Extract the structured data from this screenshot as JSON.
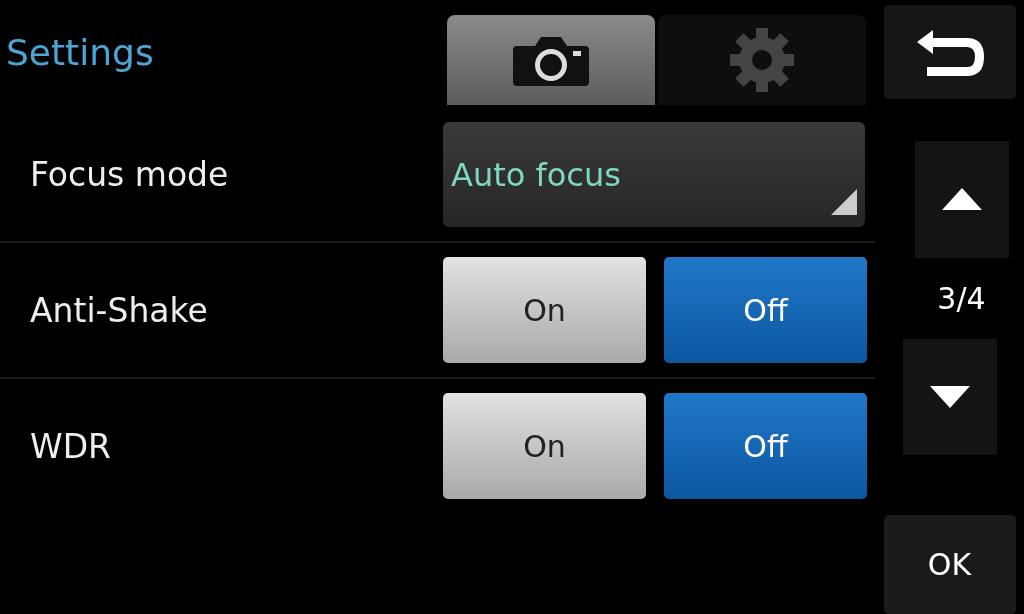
{
  "title": "Settings",
  "tabs": [
    {
      "kind": "camera",
      "selected": true
    },
    {
      "kind": "gear",
      "selected": false
    }
  ],
  "rows": [
    {
      "kind": "dropdown",
      "label": "Focus mode",
      "value": "Auto focus"
    },
    {
      "kind": "toggle",
      "label": "Anti-Shake",
      "options": [
        {
          "label": "On",
          "selected": false
        },
        {
          "label": "Off",
          "selected": true
        }
      ]
    },
    {
      "kind": "toggle",
      "label": "WDR",
      "options": [
        {
          "label": "On",
          "selected": false
        },
        {
          "label": "Off",
          "selected": true
        }
      ]
    }
  ],
  "page": "3/4",
  "ok": "OK"
}
